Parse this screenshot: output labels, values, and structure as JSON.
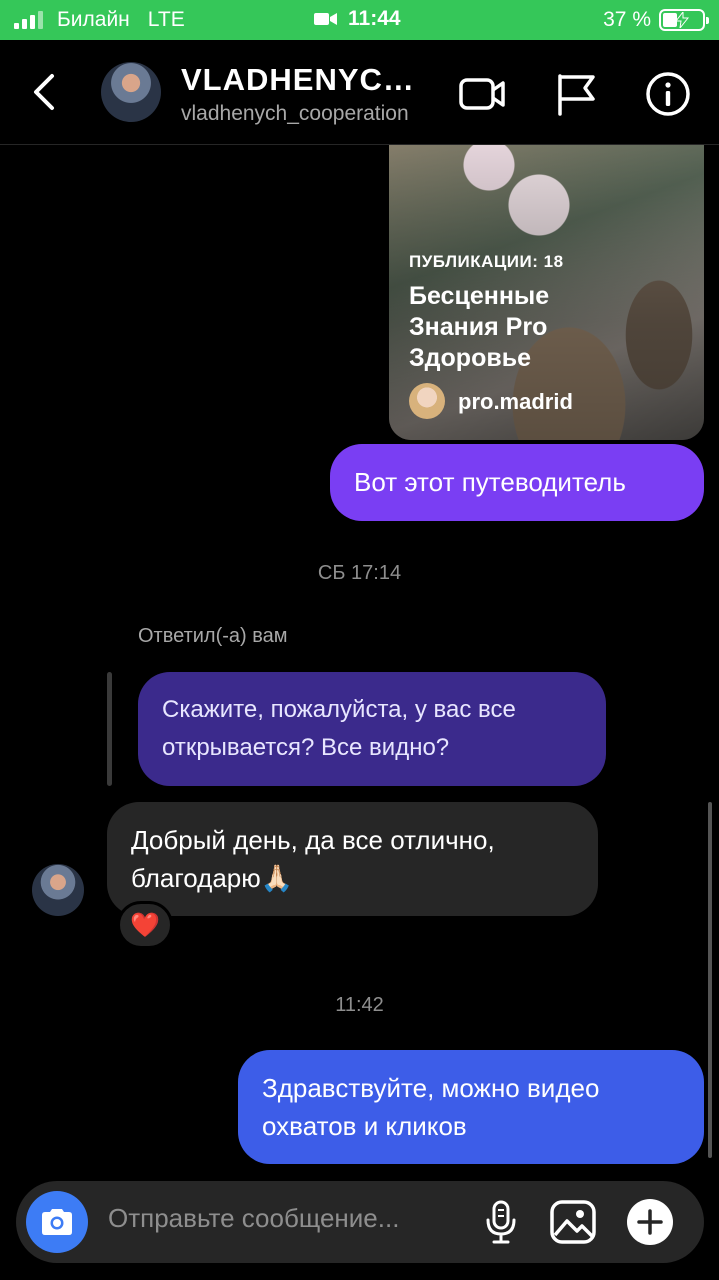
{
  "status_bar": {
    "carrier": "Билайн",
    "network": "LTE",
    "time": "11:44",
    "battery": "37 %",
    "battery_level": 0.37,
    "bar_color": "#35c759"
  },
  "header": {
    "title": "VLADHENYCH_COOPERATION",
    "subtitle": "vladhenych_cooperation",
    "icons": [
      "back-chevron-icon",
      "video-call-icon",
      "flag-icon",
      "info-icon"
    ]
  },
  "shared_post": {
    "count_label": "ПУБЛИКАЦИИ: 18",
    "title": "Бесценные Знания Pro Здоровье",
    "author": "pro.madrid"
  },
  "messages": {
    "guide": "Вот этот путеводитель",
    "timestamp_sat": "СБ 17:14",
    "replied_label": "Ответил(-а) вам",
    "quoted": "Скажите, пожалуйста, у вас все открывается? Все видно?",
    "reply": "Добрый день, да все отлично, благодарю🙏🏻",
    "reaction": "❤️",
    "timestamp_now": "11:42",
    "latest": "Здравствуйте, можно видео охватов и кликов"
  },
  "composer": {
    "placeholder": "Отправьте сообщение...",
    "icons": [
      "camera-icon",
      "microphone-icon",
      "gallery-icon",
      "plus-icon"
    ]
  },
  "colors": {
    "outgoing_violet": "#7a3ef3",
    "outgoing_blue": "#3d5de8",
    "quoted": "#3b2a8c",
    "incoming": "#262626",
    "camera_button": "#3d7cf5"
  }
}
